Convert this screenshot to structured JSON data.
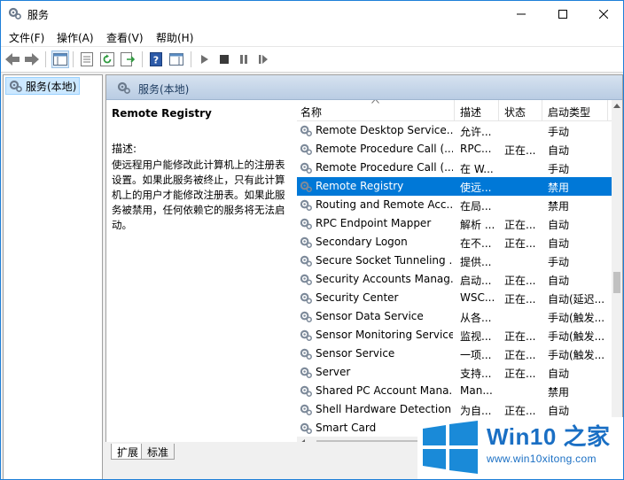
{
  "window": {
    "title": "服务"
  },
  "menu": {
    "items": [
      "文件(F)",
      "操作(A)",
      "查看(V)",
      "帮助(H)"
    ]
  },
  "toolbar": {
    "icons": [
      "back-icon",
      "forward-icon",
      "console-tree-icon",
      "properties-icon",
      "refresh-icon",
      "export-icon",
      "help-icon",
      "view-icon",
      "start-icon",
      "stop-icon",
      "pause-icon",
      "restart-icon"
    ]
  },
  "tree": {
    "root_label": "服务(本地)"
  },
  "panel": {
    "header": "服务(本地)"
  },
  "description": {
    "title": "Remote Registry",
    "label": "描述:",
    "text": "使远程用户能修改此计算机上的注册表设置。如果此服务被终止，只有此计算机上的用户才能修改注册表。如果此服务被禁用，任何依赖它的服务将无法启动。"
  },
  "table": {
    "columns": [
      "名称",
      "描述",
      "状态",
      "启动类型"
    ],
    "rows": [
      {
        "name": "Remote Desktop Service...",
        "desc": "允许...",
        "status": "",
        "startup": "手动"
      },
      {
        "name": "Remote Procedure Call (...",
        "desc": "RPC...",
        "status": "正在...",
        "startup": "自动"
      },
      {
        "name": "Remote Procedure Call (...",
        "desc": "在 W...",
        "status": "",
        "startup": "手动"
      },
      {
        "name": "Remote Registry",
        "desc": "使远...",
        "status": "",
        "startup": "禁用",
        "selected": true
      },
      {
        "name": "Routing and Remote Acc...",
        "desc": "在局...",
        "status": "",
        "startup": "禁用"
      },
      {
        "name": "RPC Endpoint Mapper",
        "desc": "解析 ...",
        "status": "正在...",
        "startup": "自动"
      },
      {
        "name": "Secondary Logon",
        "desc": "在不...",
        "status": "正在...",
        "startup": "自动"
      },
      {
        "name": "Secure Socket Tunneling ...",
        "desc": "提供...",
        "status": "",
        "startup": "手动"
      },
      {
        "name": "Security Accounts Manag...",
        "desc": "启动...",
        "status": "正在...",
        "startup": "自动"
      },
      {
        "name": "Security Center",
        "desc": "WSC...",
        "status": "正在...",
        "startup": "自动(延迟..."
      },
      {
        "name": "Sensor Data Service",
        "desc": "从各...",
        "status": "",
        "startup": "手动(触发..."
      },
      {
        "name": "Sensor Monitoring Service",
        "desc": "监视...",
        "status": "正在...",
        "startup": "手动(触发..."
      },
      {
        "name": "Sensor Service",
        "desc": "一项...",
        "status": "正在...",
        "startup": "手动(触发..."
      },
      {
        "name": "Server",
        "desc": "支持...",
        "status": "正在...",
        "startup": "自动"
      },
      {
        "name": "Shared PC Account Mana...",
        "desc": "Man...",
        "status": "",
        "startup": "禁用"
      },
      {
        "name": "Shell Hardware Detection",
        "desc": "为自...",
        "status": "正在...",
        "startup": "自动"
      },
      {
        "name": "Smart Card",
        "desc": "",
        "status": "",
        "startup": ""
      }
    ]
  },
  "tabs": [
    "扩展",
    "标准"
  ],
  "watermark": {
    "title": "Win10 之家",
    "url": "www.win10xitong.com"
  },
  "colors": {
    "selection": "#0078d7",
    "watermark": "#1a6fc4"
  }
}
